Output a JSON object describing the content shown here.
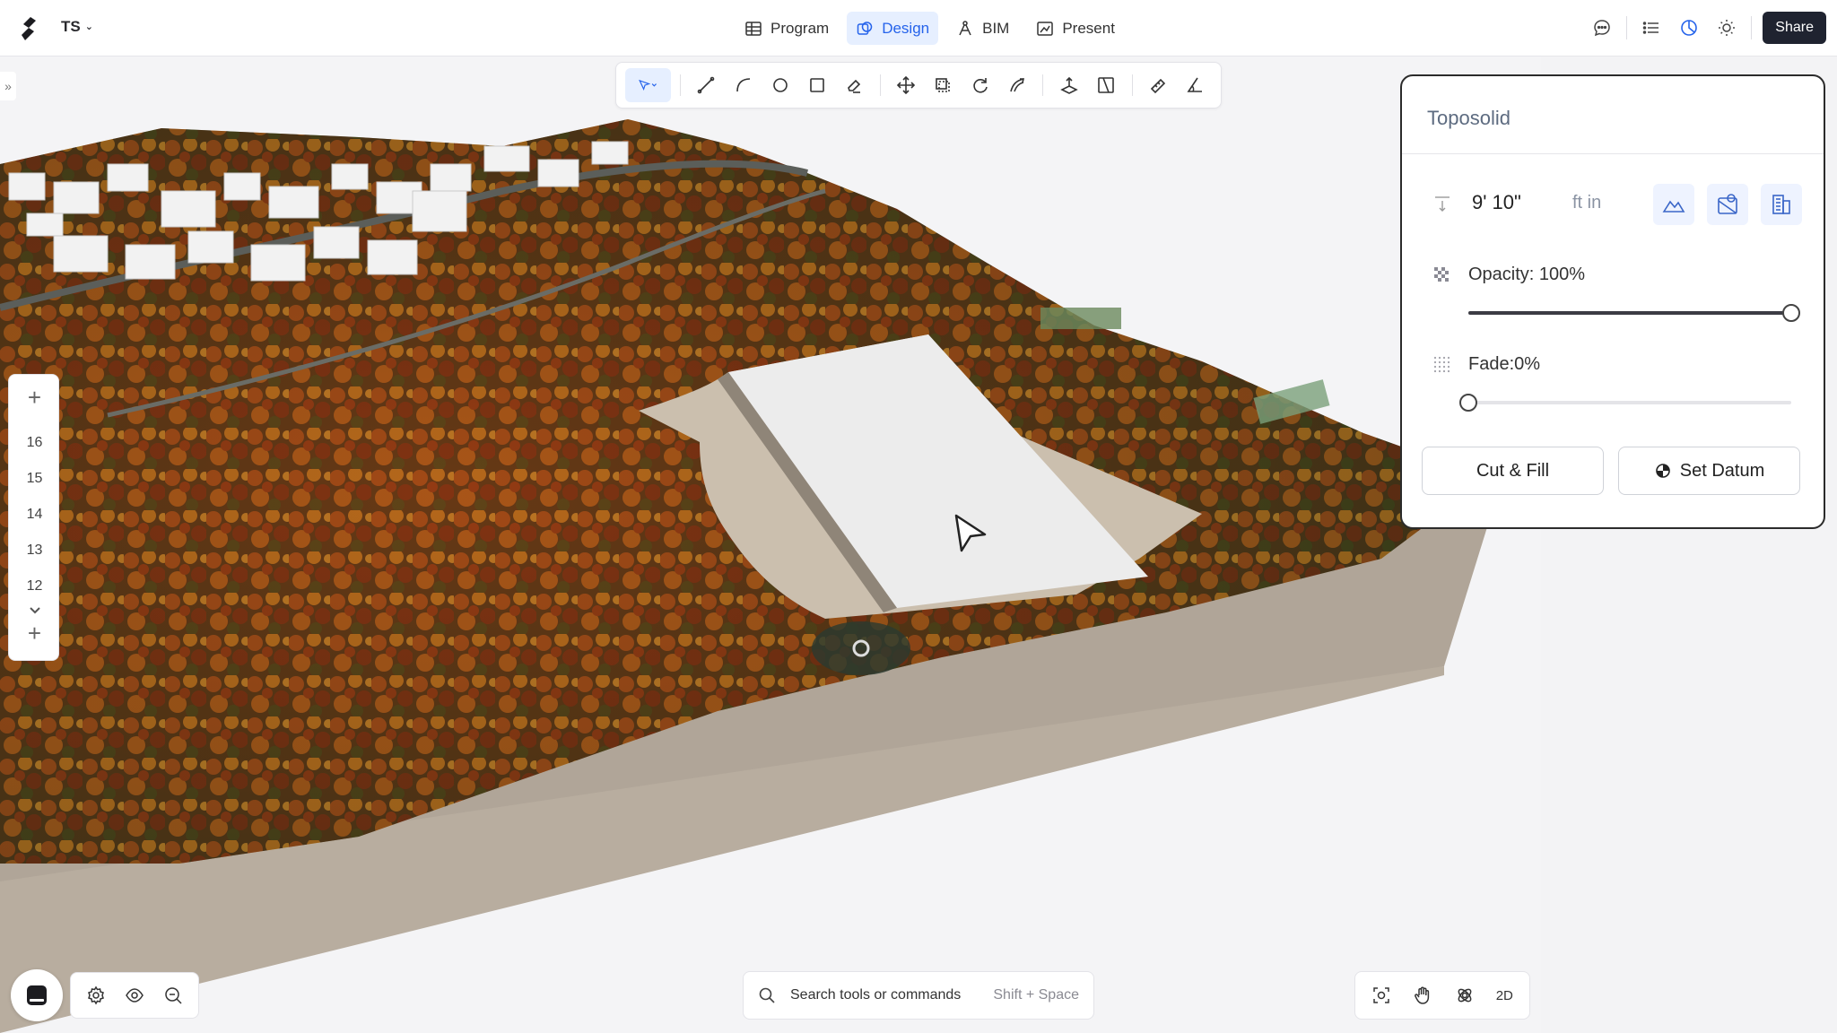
{
  "header": {
    "project": "TS",
    "nav": [
      {
        "label": "Program",
        "icon": "table-icon",
        "active": false
      },
      {
        "label": "Design",
        "icon": "design-icon",
        "active": true
      },
      {
        "label": "BIM",
        "icon": "compass-icon",
        "active": false
      },
      {
        "label": "Present",
        "icon": "present-icon",
        "active": false
      }
    ],
    "share_label": "Share"
  },
  "toolbar": {
    "tools": [
      "select-icon",
      "line-icon",
      "arc-icon",
      "circle-icon",
      "rectangle-icon",
      "eraser-icon",
      "move-icon",
      "copy-icon",
      "rotate-icon",
      "offset-icon",
      "push-pull-icon",
      "flip-icon",
      "tape-measure-icon",
      "angle-icon"
    ]
  },
  "levels": {
    "items": [
      "16",
      "15",
      "14",
      "13",
      "12"
    ]
  },
  "panel": {
    "title": "Toposolid",
    "height_value": "9' 10\"",
    "units": "ft in",
    "opacity_label": "Opacity: 100%",
    "opacity_value": 1.0,
    "fade_label": "Fade:0%",
    "fade_value": 0.0,
    "cut_fill_label": "Cut & Fill",
    "set_datum_label": "Set Datum"
  },
  "search": {
    "placeholder": "Search tools or commands",
    "shortcut": "Shift + Space"
  },
  "view_controls": {
    "mode_label": "2D"
  },
  "colors": {
    "accent": "#2563eb",
    "active_bg": "#e6efff",
    "share_bg": "#1f2330"
  }
}
